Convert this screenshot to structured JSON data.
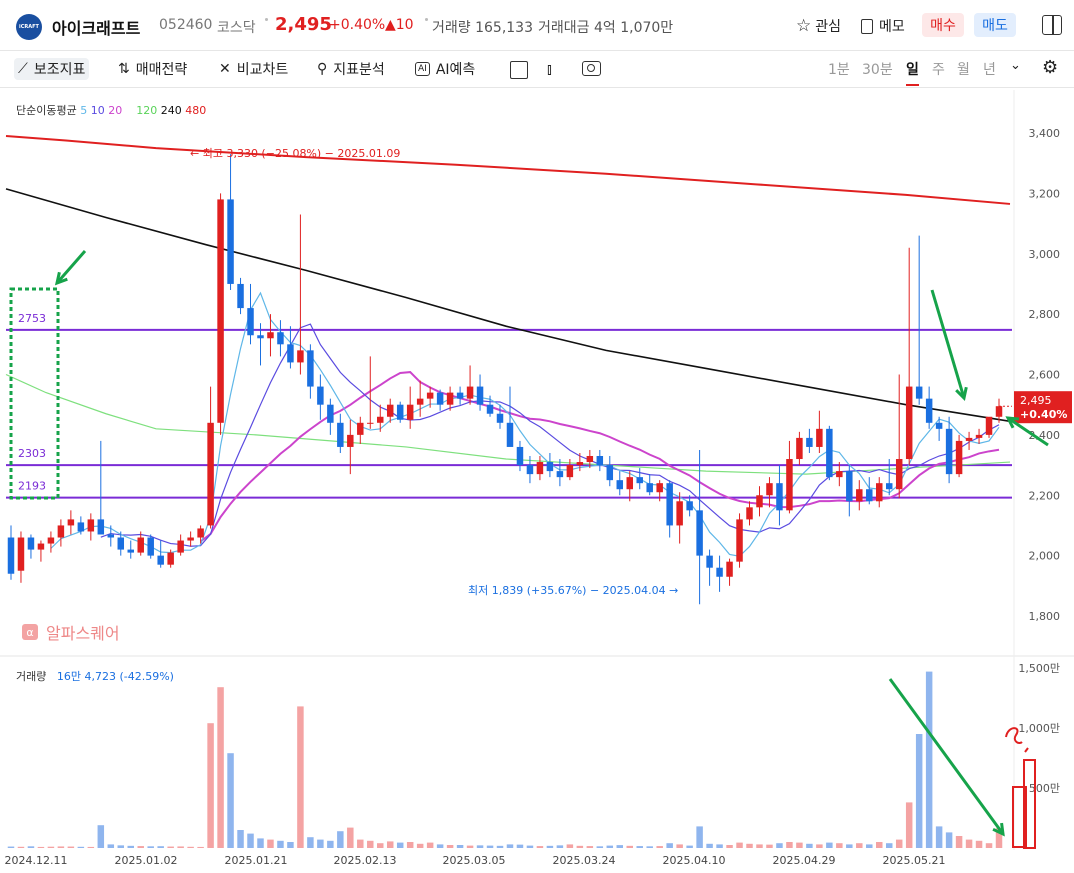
{
  "header": {
    "logo_text": "iCRAFT",
    "name": "아이크래프트",
    "code": "052460",
    "market": "코스닥",
    "price": "2,495",
    "pct": "+0.40%",
    "change": "▲10",
    "volume_label": "거래량",
    "volume": "165,133",
    "amount_label": "거래대금",
    "amount": "4억 1,070만",
    "interest": "관심",
    "memo": "메모",
    "buy": "매수",
    "sell": "매도"
  },
  "toolbar": {
    "indicators": "보조지표",
    "strategy": "매매전략",
    "compare": "비교차트",
    "analysis": "지표분석",
    "ai": "AI예측",
    "periods": [
      "1분",
      "30분",
      "일",
      "주",
      "월",
      "년"
    ],
    "active_period": "일"
  },
  "legend": {
    "label": "단순이동평균",
    "ma": [
      {
        "v": "5",
        "color": "#5fb7e8"
      },
      {
        "v": "10",
        "color": "#5a4be0"
      },
      {
        "v": "20",
        "color": "#cc44cc"
      },
      {
        "v": "120",
        "color": "#5ad35a"
      },
      {
        "v": "240",
        "color": "#111111"
      },
      {
        "v": "480",
        "color": "#e02020"
      }
    ]
  },
  "watermark": "알파스퀘어",
  "volume_legend": {
    "label": "거래량",
    "value": "16만 4,723 (-42.59%)"
  },
  "chart_data": {
    "type": "candlestick",
    "y_axis": {
      "ticks": [
        "1,800",
        "2,000",
        "2,200",
        "2,400",
        "2,600",
        "2,800",
        "3,000",
        "3,200",
        "3,400"
      ],
      "ylim": [
        1750,
        3450
      ]
    },
    "vol_axis": {
      "ticks": [
        "500만",
        "1,000만",
        "1,500만"
      ]
    },
    "x_labels": [
      "2024.12.11",
      "2025.01.02",
      "2025.01.21",
      "2025.02.13",
      "2025.03.05",
      "2025.03.24",
      "2025.04.10",
      "2025.04.29",
      "2025.05.21"
    ],
    "levels": [
      {
        "label": "2753",
        "value": 2748
      },
      {
        "label": "2303",
        "value": 2300
      },
      {
        "label": "2193",
        "value": 2192
      }
    ],
    "annotations": {
      "high": "최고 3,330 (−25.08%) − 2025.01.09",
      "low": "최저 1,839 (+35.67%) − 2025.04.04"
    },
    "last_price": {
      "price": "2,495",
      "pct": "+0.40%"
    },
    "ma_lines": {
      "ma480": [
        [
          0,
          3390
        ],
        [
          60,
          3375
        ],
        [
          150,
          3350
        ],
        [
          300,
          3320
        ],
        [
          450,
          3295
        ],
        [
          600,
          3265
        ],
        [
          750,
          3230
        ],
        [
          900,
          3195
        ],
        [
          1004,
          3165
        ]
      ],
      "ma240": [
        [
          0,
          3215
        ],
        [
          100,
          3120
        ],
        [
          200,
          3030
        ],
        [
          300,
          2945
        ],
        [
          400,
          2855
        ],
        [
          500,
          2760
        ],
        [
          600,
          2680
        ],
        [
          700,
          2620
        ],
        [
          800,
          2560
        ],
        [
          900,
          2500
        ],
        [
          1004,
          2445
        ]
      ],
      "ma120": [
        [
          0,
          2600
        ],
        [
          40,
          2540
        ],
        [
          100,
          2470
        ],
        [
          150,
          2420
        ],
        [
          250,
          2400
        ],
        [
          400,
          2360
        ],
        [
          500,
          2320
        ],
        [
          600,
          2300
        ],
        [
          700,
          2280
        ],
        [
          800,
          2270
        ],
        [
          900,
          2290
        ],
        [
          1004,
          2310
        ]
      ]
    },
    "candles": [
      [
        2060,
        2100,
        1920,
        1940
      ],
      [
        1950,
        2080,
        1910,
        2060
      ],
      [
        2060,
        2070,
        1990,
        2020
      ],
      [
        2020,
        2050,
        1980,
        2040
      ],
      [
        2040,
        2080,
        2010,
        2060
      ],
      [
        2060,
        2120,
        2030,
        2100
      ],
      [
        2100,
        2150,
        2070,
        2120
      ],
      [
        2110,
        2130,
        2070,
        2080
      ],
      [
        2080,
        2140,
        2050,
        2120
      ],
      [
        2120,
        2380,
        2110,
        2070
      ],
      [
        2070,
        2100,
        2030,
        2060
      ],
      [
        2060,
        2080,
        2000,
        2020
      ],
      [
        2020,
        2050,
        1990,
        2010
      ],
      [
        2010,
        2080,
        2000,
        2060
      ],
      [
        2060,
        2070,
        1990,
        2000
      ],
      [
        2000,
        2050,
        1960,
        1970
      ],
      [
        1970,
        2020,
        1960,
        2010
      ],
      [
        2010,
        2070,
        2000,
        2050
      ],
      [
        2050,
        2080,
        2030,
        2060
      ],
      [
        2060,
        2100,
        2040,
        2090
      ],
      [
        2100,
        2560,
        2090,
        2440
      ],
      [
        2440,
        3200,
        2400,
        3180
      ],
      [
        3180,
        3330,
        2880,
        2900
      ],
      [
        2900,
        2920,
        2800,
        2820
      ],
      [
        2820,
        2900,
        2700,
        2730
      ],
      [
        2730,
        2770,
        2630,
        2720
      ],
      [
        2720,
        2800,
        2660,
        2740
      ],
      [
        2740,
        2780,
        2660,
        2700
      ],
      [
        2700,
        2760,
        2620,
        2640
      ],
      [
        2640,
        3130,
        2600,
        2680
      ],
      [
        2680,
        2700,
        2520,
        2560
      ],
      [
        2560,
        2600,
        2450,
        2500
      ],
      [
        2500,
        2520,
        2400,
        2440
      ],
      [
        2440,
        2470,
        2340,
        2360
      ],
      [
        2360,
        2450,
        2270,
        2400
      ],
      [
        2400,
        2460,
        2370,
        2440
      ],
      [
        2440,
        2660,
        2420,
        2440
      ],
      [
        2440,
        2500,
        2410,
        2460
      ],
      [
        2460,
        2520,
        2440,
        2500
      ],
      [
        2500,
        2510,
        2440,
        2450
      ],
      [
        2450,
        2560,
        2420,
        2500
      ],
      [
        2500,
        2580,
        2460,
        2520
      ],
      [
        2520,
        2560,
        2490,
        2540
      ],
      [
        2540,
        2550,
        2480,
        2500
      ],
      [
        2500,
        2560,
        2480,
        2540
      ],
      [
        2540,
        2560,
        2500,
        2520
      ],
      [
        2520,
        2630,
        2500,
        2560
      ],
      [
        2560,
        2600,
        2480,
        2500
      ],
      [
        2500,
        2530,
        2460,
        2470
      ],
      [
        2470,
        2500,
        2420,
        2440
      ],
      [
        2440,
        2560,
        2380,
        2360
      ],
      [
        2360,
        2380,
        2280,
        2300
      ],
      [
        2300,
        2330,
        2240,
        2270
      ],
      [
        2270,
        2330,
        2250,
        2310
      ],
      [
        2310,
        2340,
        2260,
        2280
      ],
      [
        2280,
        2320,
        2230,
        2260
      ],
      [
        2260,
        2320,
        2250,
        2300
      ],
      [
        2300,
        2340,
        2280,
        2310
      ],
      [
        2310,
        2350,
        2290,
        2330
      ],
      [
        2330,
        2350,
        2280,
        2300
      ],
      [
        2300,
        2330,
        2230,
        2250
      ],
      [
        2250,
        2280,
        2200,
        2220
      ],
      [
        2220,
        2280,
        2180,
        2260
      ],
      [
        2260,
        2290,
        2220,
        2240
      ],
      [
        2240,
        2270,
        2200,
        2210
      ],
      [
        2210,
        2250,
        2180,
        2240
      ],
      [
        2240,
        2250,
        2060,
        2100
      ],
      [
        2100,
        2210,
        2040,
        2180
      ],
      [
        2180,
        2200,
        2130,
        2150
      ],
      [
        2150,
        2350,
        1839,
        2000
      ],
      [
        2000,
        2020,
        1900,
        1960
      ],
      [
        1960,
        2000,
        1880,
        1930
      ],
      [
        1930,
        1990,
        1900,
        1980
      ],
      [
        1980,
        2140,
        1960,
        2120
      ],
      [
        2120,
        2180,
        2100,
        2160
      ],
      [
        2160,
        2230,
        2130,
        2200
      ],
      [
        2200,
        2260,
        2160,
        2240
      ],
      [
        2240,
        2300,
        2100,
        2150
      ],
      [
        2150,
        2380,
        2140,
        2320
      ],
      [
        2320,
        2410,
        2300,
        2390
      ],
      [
        2390,
        2420,
        2340,
        2360
      ],
      [
        2360,
        2480,
        2340,
        2420
      ],
      [
        2420,
        2430,
        2250,
        2260
      ],
      [
        2260,
        2310,
        2230,
        2280
      ],
      [
        2280,
        2300,
        2130,
        2180
      ],
      [
        2180,
        2250,
        2150,
        2220
      ],
      [
        2220,
        2260,
        2170,
        2180
      ],
      [
        2180,
        2260,
        2160,
        2240
      ],
      [
        2240,
        2320,
        2200,
        2220
      ],
      [
        2220,
        2600,
        2190,
        2320
      ],
      [
        2320,
        3020,
        2300,
        2560
      ],
      [
        2560,
        3060,
        2500,
        2520
      ],
      [
        2520,
        2560,
        2420,
        2440
      ],
      [
        2440,
        2460,
        2380,
        2420
      ],
      [
        2420,
        2460,
        2240,
        2270
      ],
      [
        2270,
        2400,
        2260,
        2380
      ],
      [
        2380,
        2410,
        2350,
        2390
      ],
      [
        2390,
        2420,
        2370,
        2400
      ],
      [
        2400,
        2450,
        2390,
        2460
      ],
      [
        2460,
        2520,
        2440,
        2495
      ]
    ],
    "volumes": [
      12,
      10,
      14,
      9,
      11,
      13,
      12,
      10,
      9,
      190,
      30,
      22,
      18,
      16,
      14,
      15,
      12,
      13,
      10,
      9,
      1040,
      1340,
      790,
      150,
      120,
      80,
      70,
      60,
      50,
      1180,
      90,
      70,
      60,
      140,
      170,
      70,
      60,
      40,
      55,
      45,
      50,
      35,
      45,
      30,
      25,
      25,
      20,
      22,
      20,
      18,
      30,
      28,
      20,
      16,
      18,
      22,
      30,
      18,
      16,
      14,
      20,
      24,
      18,
      16,
      14,
      16,
      40,
      30,
      20,
      180,
      35,
      30,
      25,
      45,
      35,
      30,
      28,
      40,
      50,
      45,
      35,
      30,
      45,
      40,
      30,
      40,
      30,
      50,
      40,
      70,
      380,
      950,
      1470,
      180,
      130,
      100,
      70,
      60,
      40,
      165
    ]
  }
}
